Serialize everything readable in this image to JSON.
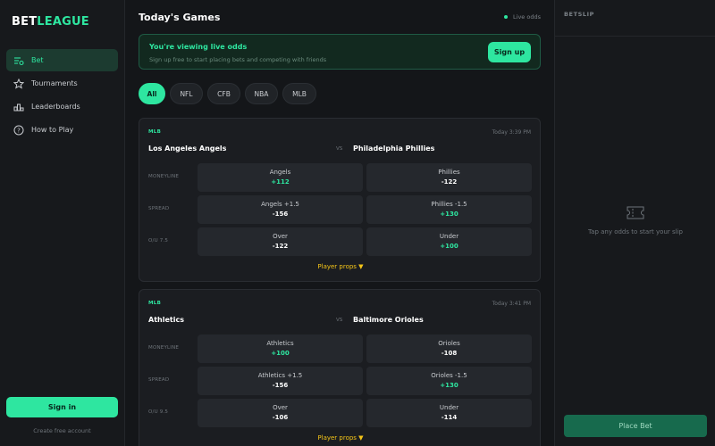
{
  "brand": {
    "part1": "BET",
    "part2": "LEAGUE"
  },
  "sidebar": {
    "items": [
      {
        "label": "Bet",
        "icon": "bet-slip-icon",
        "active": true
      },
      {
        "label": "Tournaments",
        "icon": "star-icon",
        "active": false
      },
      {
        "label": "Leaderboards",
        "icon": "podium-icon",
        "active": false
      },
      {
        "label": "How to Play",
        "icon": "help-icon",
        "active": false
      }
    ],
    "sign_in": "Sign in",
    "create_account": "Create free account"
  },
  "main": {
    "title": "Today's Games",
    "live_indicator": "Live odds",
    "banner": {
      "title": "You're viewing live odds",
      "subtitle": "Sign up free to start placing bets and competing with friends",
      "button": "Sign up"
    },
    "filters": [
      "All",
      "NFL",
      "CFB",
      "NBA",
      "MLB"
    ],
    "active_filter": "All",
    "games": [
      {
        "league": "MLB",
        "time": "Today 3:39 PM",
        "home": "Los Angeles Angels",
        "vs": "VS",
        "away": "Philadelphia Phillies",
        "markets": [
          {
            "label": "MONEYLINE",
            "odds": [
              {
                "label": "Angels",
                "value": "+112"
              },
              {
                "label": "Phillies",
                "value": "-122"
              }
            ]
          },
          {
            "label": "SPREAD",
            "odds": [
              {
                "label": "Angels +1.5",
                "value": "-156"
              },
              {
                "label": "Phillies -1.5",
                "value": "+130"
              }
            ]
          },
          {
            "label": "O/U 7.5",
            "odds": [
              {
                "label": "Over",
                "value": "-122"
              },
              {
                "label": "Under",
                "value": "+100"
              }
            ]
          }
        ],
        "props": "Player props ▼"
      },
      {
        "league": "MLB",
        "time": "Today 3:41 PM",
        "home": "Athletics",
        "vs": "VS",
        "away": "Baltimore Orioles",
        "markets": [
          {
            "label": "MONEYLINE",
            "odds": [
              {
                "label": "Athletics",
                "value": "+100"
              },
              {
                "label": "Orioles",
                "value": "-108"
              }
            ]
          },
          {
            "label": "SPREAD",
            "odds": [
              {
                "label": "Athletics +1.5",
                "value": "-156"
              },
              {
                "label": "Orioles -1.5",
                "value": "+130"
              }
            ]
          },
          {
            "label": "O/U 9.5",
            "odds": [
              {
                "label": "Over",
                "value": "-106"
              },
              {
                "label": "Under",
                "value": "-114"
              }
            ]
          }
        ],
        "props": "Player props ▼"
      }
    ]
  },
  "betslip": {
    "header": "BETSLIP",
    "empty_text": "Tap any odds to start your slip",
    "place_button": "Place Bet",
    "icon": "ticket-icon"
  },
  "colors": {
    "accent": "#2ee6a0",
    "background": "#141619",
    "props": "#f5c518"
  }
}
